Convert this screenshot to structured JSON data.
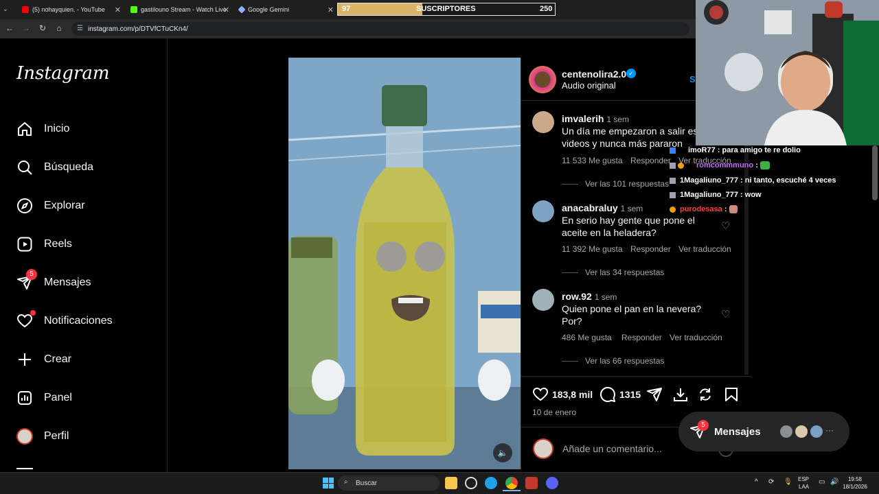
{
  "browser": {
    "tabs": [
      {
        "label": "(5) nohayquien. - YouTube",
        "color": "#ff0000"
      },
      {
        "label": "gastilouno Stream - Watch Live",
        "color": "#53fc18"
      },
      {
        "label": "Google Gemini",
        "color": "#8ab4f8"
      }
    ],
    "url": "instagram.com/p/DTVfCTuCKn4/"
  },
  "subscribers": {
    "left": "97",
    "label": "SUSCRIPTORES",
    "right": "250",
    "progress": 0.388
  },
  "sidebar": {
    "logo": "Instagram",
    "items": [
      {
        "label": "Inicio",
        "icon": "home-icon"
      },
      {
        "label": "Búsqueda",
        "icon": "search-icon"
      },
      {
        "label": "Explorar",
        "icon": "compass-icon"
      },
      {
        "label": "Reels",
        "icon": "reels-icon"
      },
      {
        "label": "Mensajes",
        "icon": "messenger-icon",
        "badge": "5"
      },
      {
        "label": "Notificaciones",
        "icon": "heart-icon"
      },
      {
        "label": "Crear",
        "icon": "plus-icon"
      },
      {
        "label": "Panel",
        "icon": "dashboard-icon"
      },
      {
        "label": "Perfil",
        "icon": "avatar"
      }
    ]
  },
  "post": {
    "author": "centenolira2.0",
    "audio": "Audio original",
    "follow": "S",
    "likes": "183,8 mil",
    "comments_count": "1315",
    "date": "10 de enero",
    "add_comment_placeholder": "Añade un comentario..."
  },
  "comments": [
    {
      "user": "imvalerih",
      "time": "1 sem",
      "text1": "Un día me empezaron a salir est",
      "text2": "videos y nunca más pararon",
      "likes": "11 533 Me gusta",
      "respond": "Responder",
      "translate": "Ver traducción",
      "replies": "Ver las 101 respuestas"
    },
    {
      "user": "anacabraluy",
      "time": "1 sem",
      "text1": "En serio hay gente que pone el",
      "text2": "aceite en la heladera?",
      "likes": "11 392 Me gusta",
      "respond": "Responder",
      "translate": "Ver traducción",
      "replies": "Ver las 34 respuestas"
    },
    {
      "user": "row.92",
      "time": "1 sem",
      "text1": "Quien pone el pan en la nevera?",
      "text2": "Por?",
      "likes": "486 Me gusta",
      "respond": "Responder",
      "translate": "Ver traducción",
      "replies": "Ver las 66 respuestas"
    }
  ],
  "chat": [
    {
      "user": "imoR77",
      "msg": ": para amigo te re dolio",
      "color": "#ffffff"
    },
    {
      "user": "romcommmuno",
      "msg": ":",
      "color": "#c86cff"
    },
    {
      "user": "1Magaliuno_777",
      "msg": ": ni tanto, escuché 4 veces",
      "color": "#ffffff"
    },
    {
      "user": "1Magaliuno_777",
      "msg": ": wow",
      "color": "#ffffff"
    },
    {
      "user": "purodesasa",
      "msg": ":",
      "color": "#ff3b3b"
    }
  ],
  "messages_pill": {
    "label": "Mensajes",
    "badge": "5"
  },
  "taskbar": {
    "search": "Buscar",
    "lang1": "ESP",
    "lang2": "LAA",
    "time": "19:58",
    "date": "18/1/2026"
  }
}
